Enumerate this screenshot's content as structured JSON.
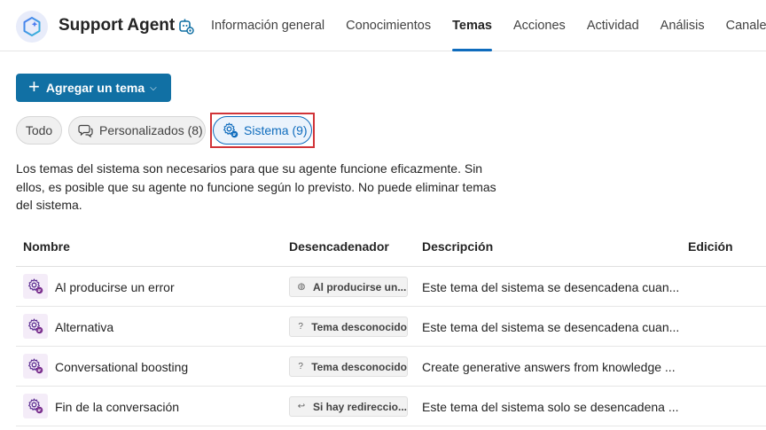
{
  "header": {
    "agent_name": "Support Agent",
    "tabs": [
      {
        "label": "Información general",
        "active": false
      },
      {
        "label": "Conocimientos",
        "active": false
      },
      {
        "label": "Temas",
        "active": true
      },
      {
        "label": "Acciones",
        "active": false
      },
      {
        "label": "Actividad",
        "active": false
      },
      {
        "label": "Análisis",
        "active": false
      },
      {
        "label": "Canales",
        "active": false
      }
    ]
  },
  "toolbar": {
    "add_label": "Agregar un tema",
    "accent_color": "#1170a4"
  },
  "filters": {
    "all": "Todo",
    "custom": "Personalizados (8)",
    "system": "Sistema (9)",
    "selected": "system",
    "highlight_color": "#d13438"
  },
  "description": "Los temas del sistema son necesarios para que su agente funcione eficazmente. Sin ellos, es posible que su agente no funcione según lo previsto. No puede eliminar temas del sistema.",
  "table": {
    "columns": {
      "name": "Nombre",
      "trigger": "Desencadenador",
      "description": "Descripción",
      "edition": "Edición"
    },
    "rows": [
      {
        "name": "Al producirse un error",
        "trigger_icon": "error-trigger-icon",
        "trigger_glyph": "◍",
        "trigger": "Al producirse un...",
        "description": "Este tema del sistema se desencadena cuan..."
      },
      {
        "name": "Alternativa",
        "trigger_icon": "unknown-topic-icon",
        "trigger_glyph": "?",
        "trigger": "Tema desconocido",
        "description": "Este tema del sistema se desencadena cuan..."
      },
      {
        "name": "Conversational boosting",
        "trigger_icon": "unknown-topic-icon",
        "trigger_glyph": "?",
        "trigger": "Tema desconocido",
        "description": "Create generative answers from knowledge ..."
      },
      {
        "name": "Fin de la conversación",
        "trigger_icon": "redirect-icon",
        "trigger_glyph": "↩",
        "trigger": "Si hay redireccio...",
        "description": "Este tema del sistema solo se desencadena ..."
      }
    ]
  }
}
